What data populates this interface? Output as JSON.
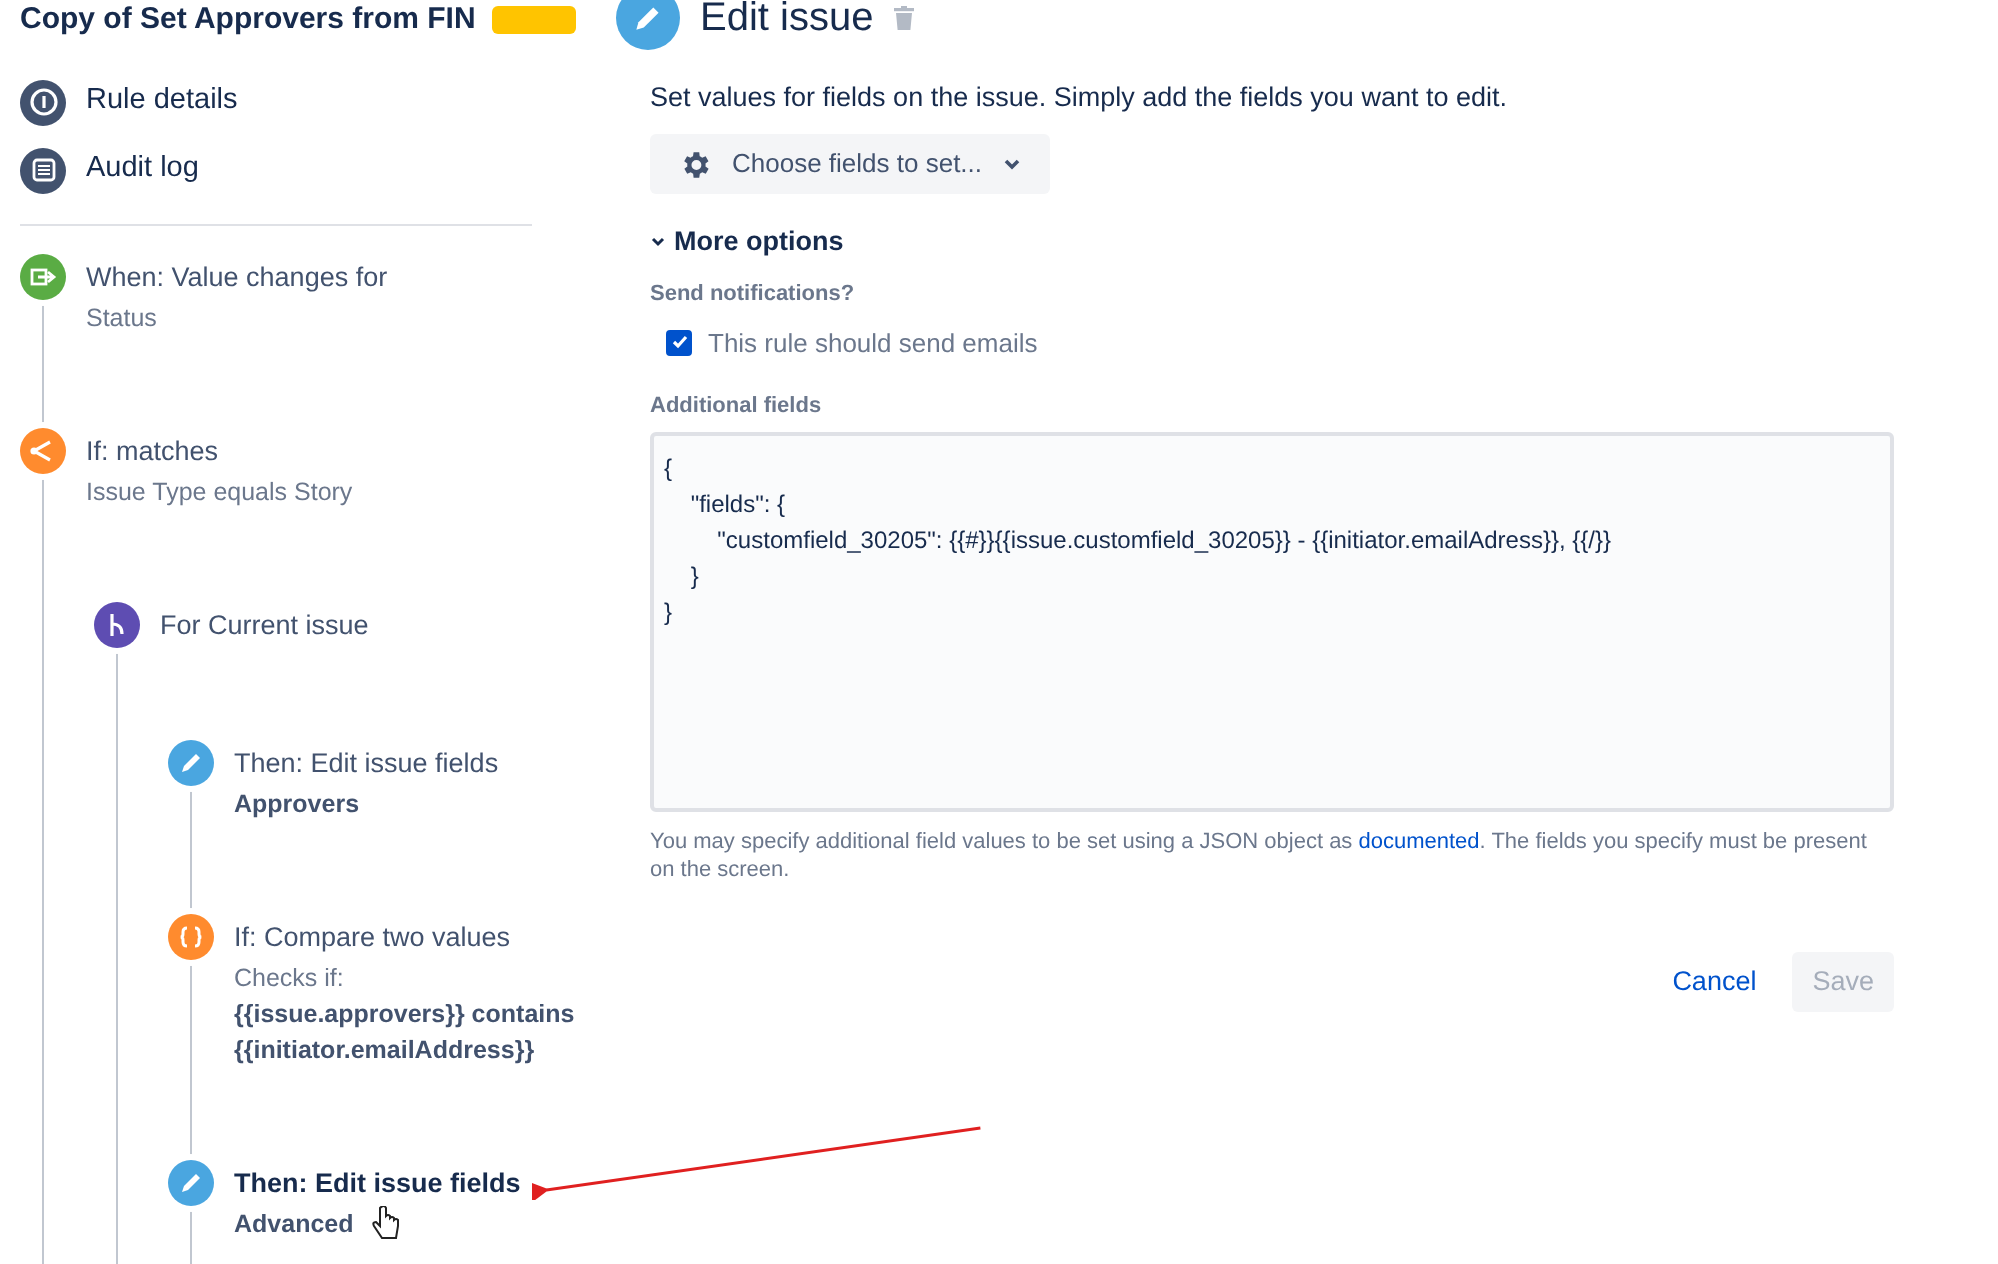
{
  "rule": {
    "title": "Copy of Set Approvers from FIN"
  },
  "menu": [
    {
      "kind": "info",
      "label": "Rule details"
    },
    {
      "kind": "log",
      "label": "Audit log"
    }
  ],
  "steps": [
    {
      "kind": "trigger",
      "title": "When: Value changes for",
      "selected": false,
      "details": [
        {
          "text": "Status",
          "bold": false
        }
      ]
    },
    {
      "kind": "condition",
      "title": "If: matches",
      "selected": false,
      "details": [
        {
          "text": "Issue Type equals Story",
          "bold": false
        }
      ],
      "children": [
        {
          "kind": "branch",
          "title": "For Current issue",
          "selected": false,
          "children": [
            {
              "kind": "action",
              "title": "Then: Edit issue fields",
              "selected": false,
              "details": [
                {
                  "text": "Approvers",
                  "bold": true
                }
              ]
            },
            {
              "kind": "compare",
              "title": "If: Compare two values",
              "selected": false,
              "details": [
                {
                  "text": "Checks if:",
                  "bold": false
                },
                {
                  "text": "{{issue.approvers}} contains {{initiator.emailAddress}}",
                  "bold": true
                }
              ]
            },
            {
              "kind": "action",
              "title": "Then: Edit issue fields",
              "selected": true,
              "details": [
                {
                  "text": "Advanced",
                  "bold": true
                }
              ]
            }
          ]
        }
      ]
    }
  ],
  "editor": {
    "title": "Edit issue",
    "description": "Set values for fields on the issue. Simply add the fields you want to edit.",
    "choose_fields": "Choose fields to set...",
    "more_options": {
      "label": "More options",
      "expanded": true
    },
    "notifications": {
      "label": "Send notifications?",
      "checkbox": "This rule should send emails",
      "checked": true
    },
    "additional_fields": {
      "label": "Additional fields",
      "value": "{\n    \"fields\": {\n        \"customfield_30205\": {{#}}{{issue.customfield_30205}} - {{initiator.emailAdress}}, {{/}}\n    }\n}"
    },
    "help": {
      "before": "You may specify additional field values to be set using a JSON object as ",
      "link": "documented",
      "after": ". The fields you specify must be present on the screen."
    },
    "buttons": [
      {
        "kind": "link",
        "label": "Cancel",
        "disabled": false
      },
      {
        "kind": "primary",
        "label": "Save",
        "disabled": true
      }
    ]
  }
}
